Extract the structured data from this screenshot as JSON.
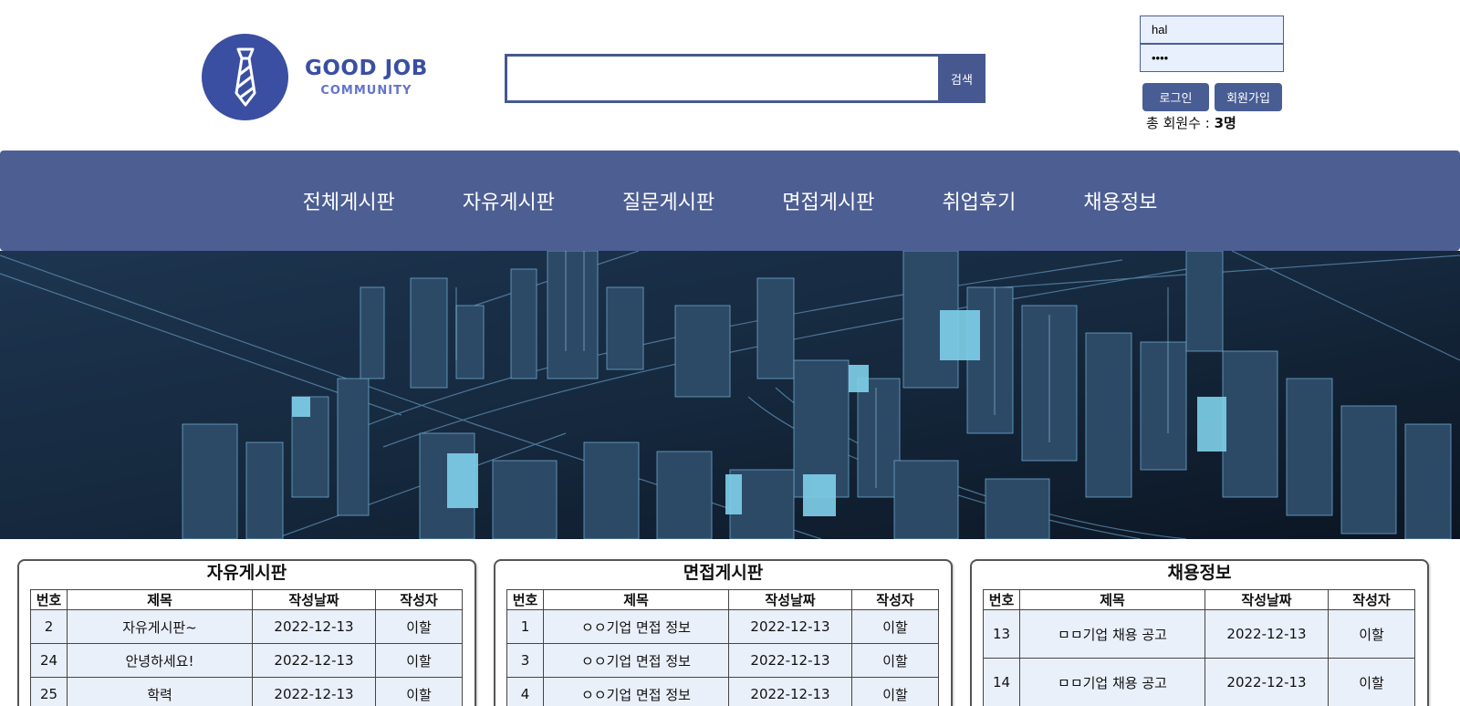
{
  "logo": {
    "title": "GOOD JOB",
    "subtitle": "COMMUNITY",
    "icon": "necktie-icon",
    "color": "#3a4fa2"
  },
  "search": {
    "button_label": "검색",
    "value": ""
  },
  "login": {
    "username_value": "hal",
    "password_value": "••••",
    "login_label": "로그인",
    "signup_label": "회원가입",
    "member_count_label": "총 회원수 : ",
    "member_count_value": "3명"
  },
  "nav": {
    "color": "#4d5e93",
    "items": [
      {
        "label": "전체게시판"
      },
      {
        "label": "자유게시판"
      },
      {
        "label": "질문게시판"
      },
      {
        "label": "면접게시판"
      },
      {
        "label": "취업후기"
      },
      {
        "label": "채용정보"
      }
    ]
  },
  "boards": [
    {
      "title": "자유게시판",
      "columns": [
        "번호",
        "제목",
        "작성날짜",
        "작성자"
      ],
      "rows": [
        {
          "no": "2",
          "title": "자유게시판~",
          "date": "2022-12-13",
          "author": "이할"
        },
        {
          "no": "24",
          "title": "안녕하세요!",
          "date": "2022-12-13",
          "author": "이할"
        },
        {
          "no": "25",
          "title": "학력",
          "date": "2022-12-13",
          "author": "이할"
        }
      ]
    },
    {
      "title": "면접게시판",
      "columns": [
        "번호",
        "제목",
        "작성날짜",
        "작성자"
      ],
      "rows": [
        {
          "no": "1",
          "title": "ㅇㅇ기업 면접 정보",
          "date": "2022-12-13",
          "author": "이할"
        },
        {
          "no": "3",
          "title": "ㅇㅇ기업 면접 정보",
          "date": "2022-12-13",
          "author": "이할"
        },
        {
          "no": "4",
          "title": "ㅇㅇ기업 면접 정보",
          "date": "2022-12-13",
          "author": "이할"
        }
      ]
    },
    {
      "title": "채용정보",
      "columns": [
        "번호",
        "제목",
        "작성날짜",
        "작성자"
      ],
      "rows": [
        {
          "no": "13",
          "title": "ㅁㅁ기업 채용 공고",
          "date": "2022-12-13",
          "author": "이할"
        },
        {
          "no": "14",
          "title": "ㅁㅁ기업 채용 공고",
          "date": "2022-12-13",
          "author": "이할"
        }
      ]
    }
  ]
}
